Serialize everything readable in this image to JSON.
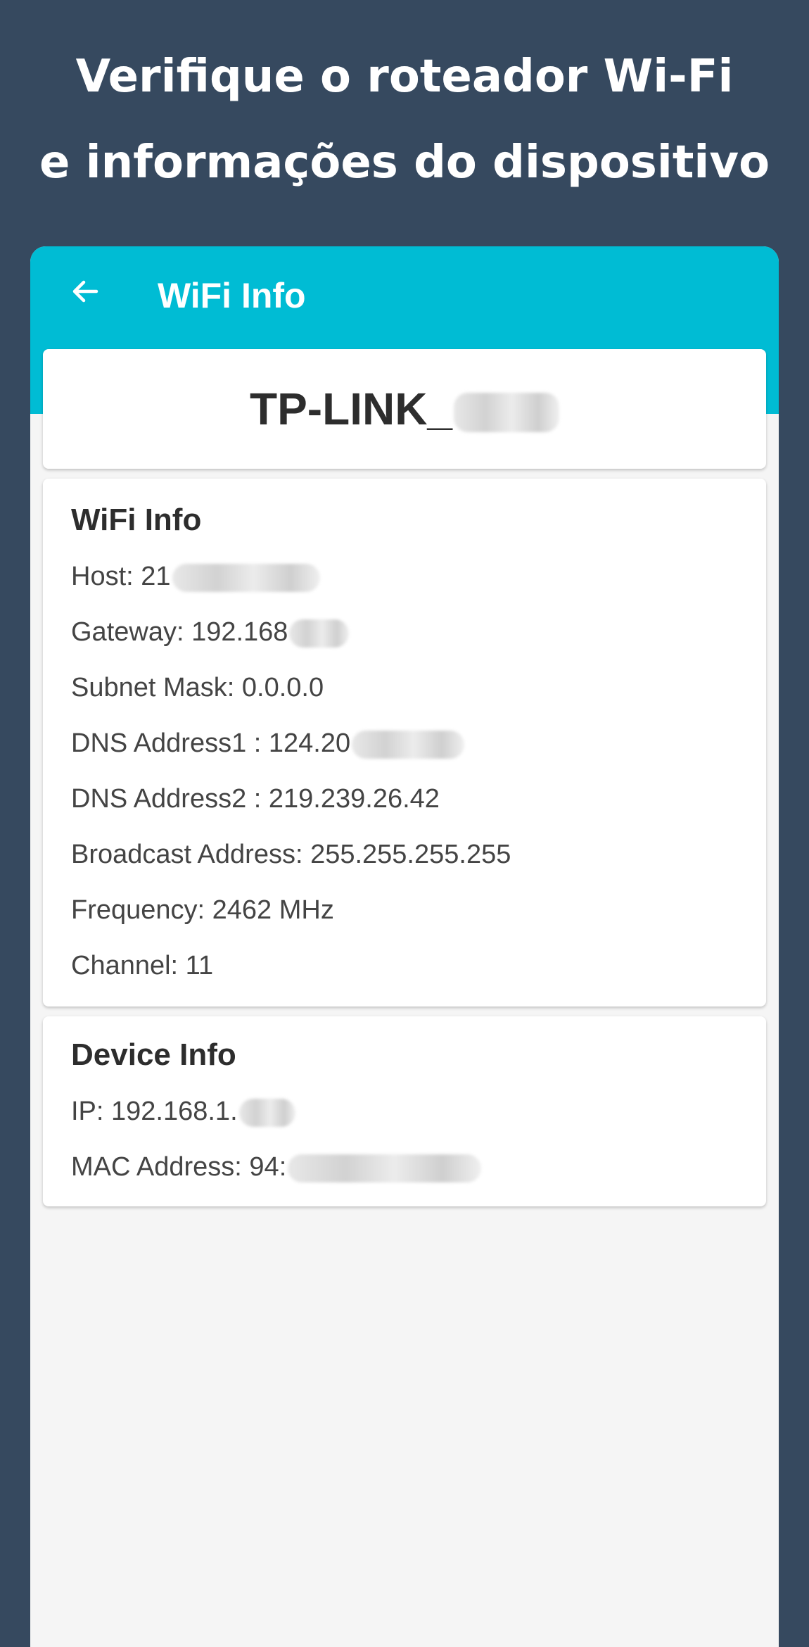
{
  "promo": {
    "line1": "Verifique o roteador Wi-Fi",
    "line2": "e informações do dispositivo"
  },
  "appbar": {
    "title": "WiFi Info",
    "back_icon": "arrow-left-icon",
    "color": "#00bcd4"
  },
  "network": {
    "ssid": "TP-LINK_"
  },
  "wifi_info": {
    "title": "WiFi Info",
    "rows": [
      "Host: 21",
      "Gateway: 192.168",
      "Subnet Mask: 0.0.0.0",
      "DNS Address1 : 124.20",
      "DNS Address2 : 219.239.26.42",
      "Broadcast Address: 255.255.255.255",
      "Frequency: 2462 MHz",
      "Channel: 11"
    ]
  },
  "device_info": {
    "title": "Device Info",
    "rows": [
      "IP: 192.168.1.",
      "MAC Address: 94:"
    ]
  },
  "colors": {
    "background": "#36495f",
    "accent": "#00bcd4",
    "card": "#ffffff",
    "screen": "#f5f5f5"
  }
}
